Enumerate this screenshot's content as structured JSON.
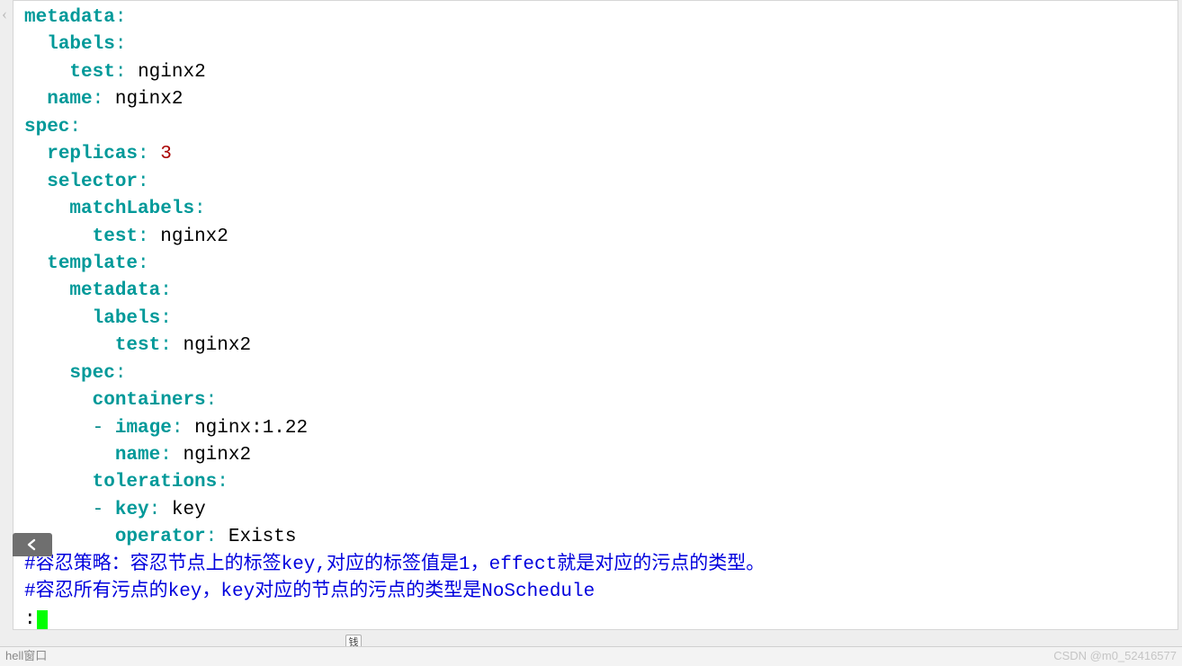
{
  "code": {
    "metadata_key": "metadata",
    "labels_key": "labels",
    "test_key": "test",
    "name_key": "name",
    "spec_key": "spec",
    "replicas_key": "replicas",
    "selector_key": "selector",
    "matchLabels_key": "matchLabels",
    "template_key": "template",
    "containers_key": "containers",
    "image_key": "image",
    "tolerations_key": "tolerations",
    "key_key": "key",
    "operator_key": "operator",
    "nginx2_val": "nginx2",
    "replicas_val": "3",
    "image_val": "nginx:1.22",
    "key_val": "key",
    "operator_val": "Exists",
    "colon": ":",
    "dash": "-",
    "comment1": "#容忍策略：容忍节点上的标签key,对应的标签值是1，effect就是对应的污点的类型。",
    "comment2": "#容忍所有污点的key，key对应的节点的污点的类型是NoSchedule"
  },
  "ui": {
    "tiny_btn_label": "钱",
    "bottom_left": "hell窗口",
    "watermark": "CSDN @m0_52416577"
  }
}
